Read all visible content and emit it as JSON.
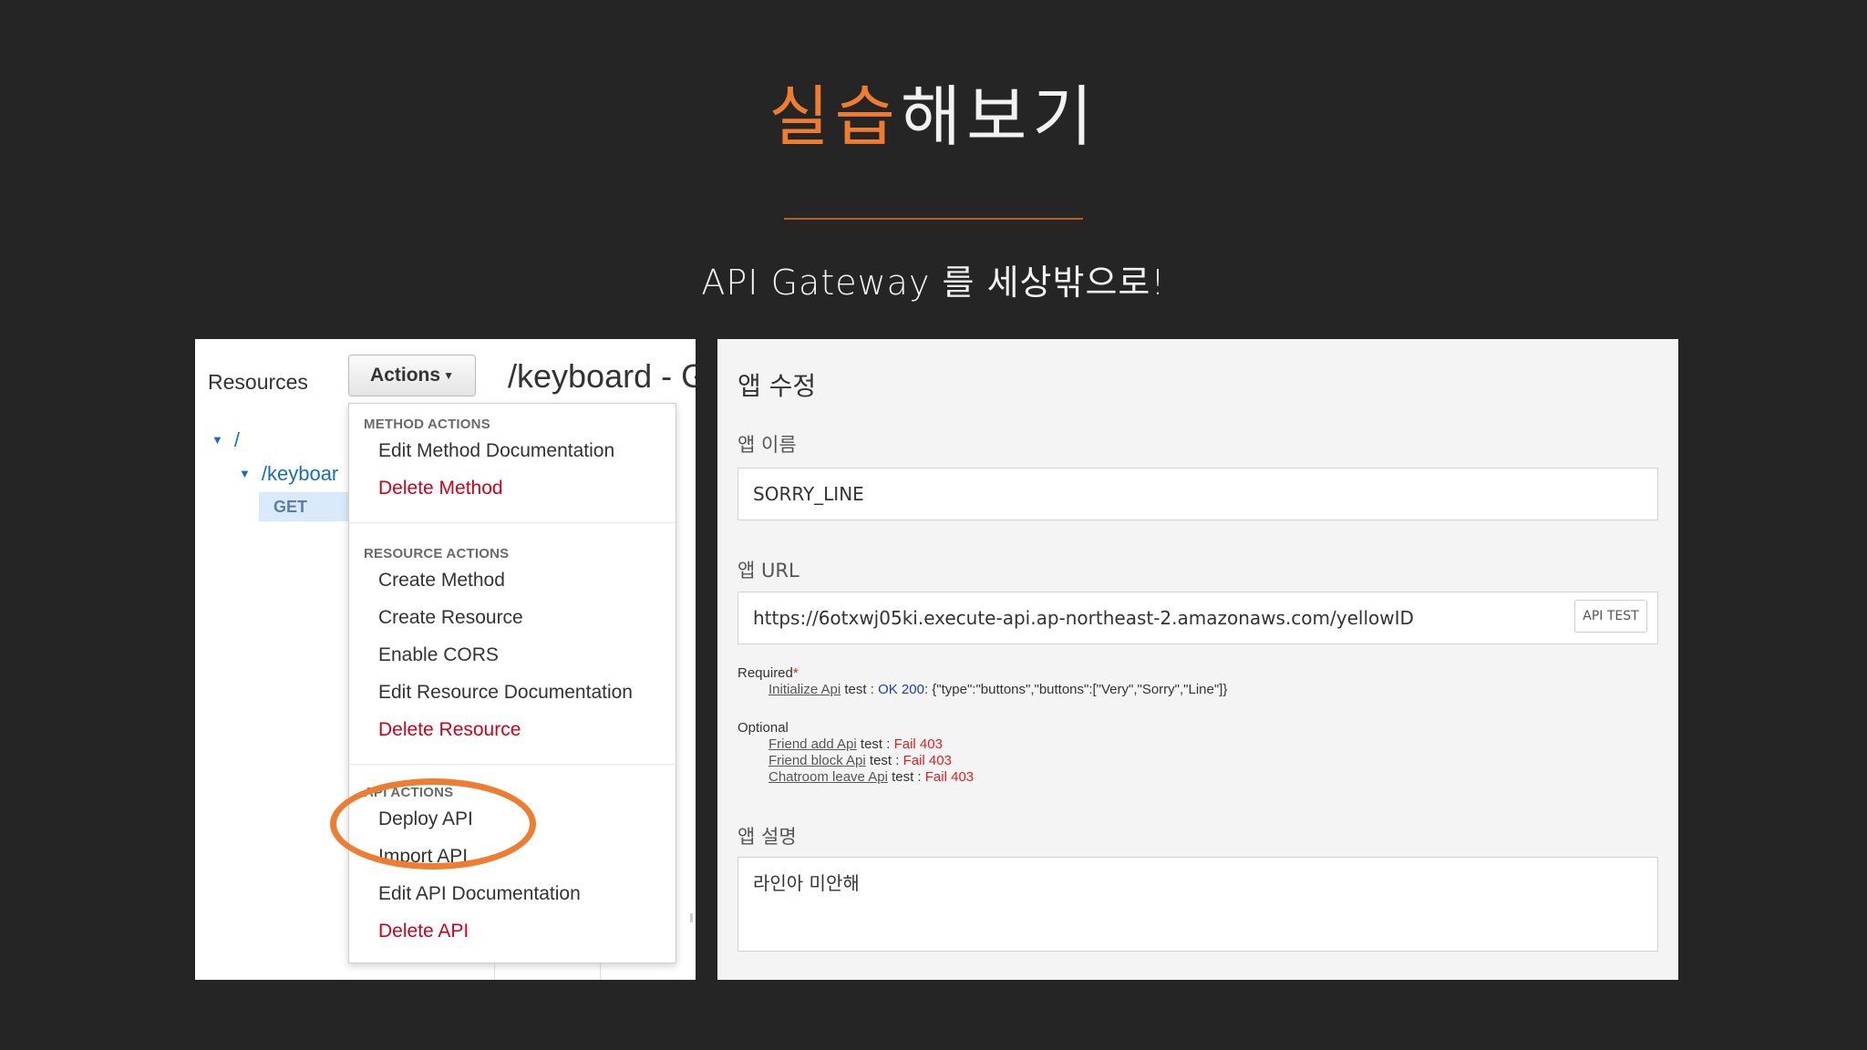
{
  "slide": {
    "title_accent": "실습",
    "title_rest": "해보기",
    "subtitle": "API Gateway 를 세상밖으로!"
  },
  "colors": {
    "accent": "#ee7d31",
    "background": "#252526",
    "danger": "#d0021b"
  },
  "gateway": {
    "resources_label": "Resources",
    "actions_label": "Actions",
    "resource_heading": "/keyboard - G",
    "tree": {
      "root": "/",
      "child": "/keyboar",
      "method": "GET"
    },
    "menu": {
      "method_header": "METHOD ACTIONS",
      "method_items": [
        "Edit Method Documentation",
        "Delete Method"
      ],
      "resource_header": "RESOURCE ACTIONS",
      "resource_items": [
        "Create Method",
        "Create Resource",
        "Enable CORS",
        "Edit Resource Documentation",
        "Delete Resource"
      ],
      "api_header": "API ACTIONS",
      "api_items": [
        "Deploy API",
        "Import API",
        "Edit API Documentation",
        "Delete API"
      ]
    }
  },
  "app_form": {
    "title": "앱 수정",
    "name_label": "앱 이름",
    "name_value": "SORRY_LINE",
    "url_label": "앱 URL",
    "url_value": "https://6otxwj05ki.execute-api.ap-northeast-2.amazonaws.com/yellowID",
    "api_test_label": "API TEST",
    "required_label": "Required",
    "required_star": "*",
    "required_tests": [
      {
        "name": "Initialize Api",
        "mid": " test : ",
        "status": "OK 200:",
        "detail": " {\"type\":\"buttons\",\"buttons\":[\"Very\",\"Sorry\",\"Line\"]}"
      }
    ],
    "optional_label": "Optional",
    "optional_tests": [
      {
        "name": "Friend add Api",
        "mid": " test : ",
        "status": "Fail 403"
      },
      {
        "name": "Friend block Api",
        "mid": " test : ",
        "status": "Fail 403"
      },
      {
        "name": "Chatroom leave Api",
        "mid": " test : ",
        "status": "Fail 403"
      }
    ],
    "desc_label": "앱 설명",
    "desc_value": "라인아 미안해"
  }
}
